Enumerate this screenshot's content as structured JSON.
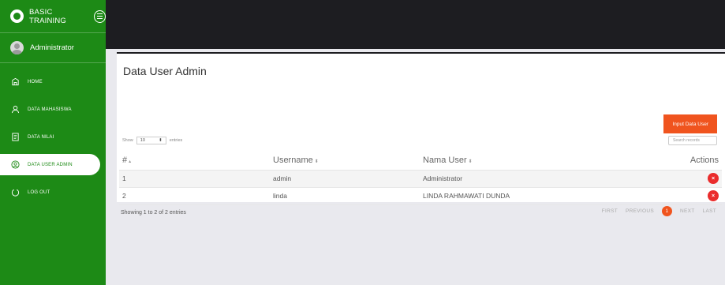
{
  "brand": {
    "title": "BASIC TRAINING"
  },
  "user": {
    "name": "Administrator"
  },
  "nav": [
    {
      "label": "HOME",
      "icon": "home-icon",
      "active": false
    },
    {
      "label": "DATA MAHASISWA",
      "icon": "user-icon",
      "active": false
    },
    {
      "label": "DATA NILAI",
      "icon": "document-icon",
      "active": false
    },
    {
      "label": "DATA USER ADMIN",
      "icon": "admin-icon",
      "active": true
    },
    {
      "label": "LOG OUT",
      "icon": "logout-icon",
      "active": false
    }
  ],
  "card": {
    "title": "Data User Admin",
    "input_button": "Input Data User",
    "length_prefix": "Show",
    "length_value": "10",
    "length_suffix": "entries",
    "search_placeholder": "Search records"
  },
  "table": {
    "headers": [
      "#",
      "Username",
      "Nama User",
      "Actions"
    ],
    "rows": [
      {
        "num": "1",
        "username": "admin",
        "nama": "Administrator",
        "action": "×"
      },
      {
        "num": "2",
        "username": "linda",
        "nama": "LINDA RAHMAWATI DUNDA",
        "action": "×"
      }
    ]
  },
  "footer": {
    "info": "Showing 1 to 2 of 2 entries",
    "first": "FIRST",
    "previous": "PREVIOUS",
    "page": "1",
    "next": "NEXT",
    "last": "LAST"
  },
  "colors": {
    "sidebar": "#1d8a16",
    "topbar": "#1d1d21",
    "accent": "#f0541e",
    "delete": "#ea2c2c"
  }
}
